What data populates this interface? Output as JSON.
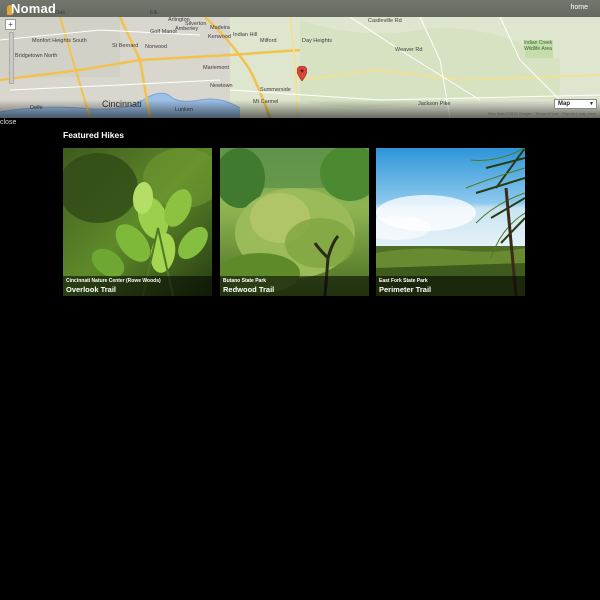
{
  "header": {
    "brand": "Nomad",
    "home_link": "home"
  },
  "map": {
    "map_type": "Map",
    "attribution": "Map data ©2013 Google · Terms of Use · Report a map error",
    "labels": {
      "oak": "Oak",
      "elk": "Elk",
      "arlington": "Arlington",
      "amberley": "Amberley",
      "kenwood": "Kenwood",
      "silverton": "Silverton",
      "madeira": "Madeira",
      "indian_hill": "Indian Hill",
      "golf_manor": "Golf Manor",
      "st_bernard": "St Bernard",
      "norwood": "Norwood",
      "monfort_heights": "Monfort Heights South",
      "bridgetown": "Bridgetown North",
      "cincinnati": "Cincinnati",
      "mariemont": "Mariemont",
      "newtown": "Newtown",
      "milford": "Milford",
      "day_heights": "Day Heights",
      "summerside": "Summerside",
      "mt_carmel": "Mt Carmel",
      "lunken": "Lunken",
      "delhi": "Delhi",
      "castleville": "Castleville Rd",
      "indian_creek": "Indian Creek Wildlife Area",
      "jackson_pike": "Jackson Pike",
      "weaver_rd": "Weaver Rd"
    }
  },
  "nav": {
    "close": "close"
  },
  "featured": {
    "title": "Featured Hikes",
    "hikes": [
      {
        "park": "Cincinnati Nature Center (Rowe Woods)",
        "trail": "Overlook Trail"
      },
      {
        "park": "Butano State Park",
        "trail": "Redwood Trail"
      },
      {
        "park": "East Fork State Park",
        "trail": "Perimeter Trail"
      }
    ]
  },
  "colors": {
    "background": "#000000",
    "map_land": "#e3e6d6",
    "pin": "#d9473a"
  }
}
